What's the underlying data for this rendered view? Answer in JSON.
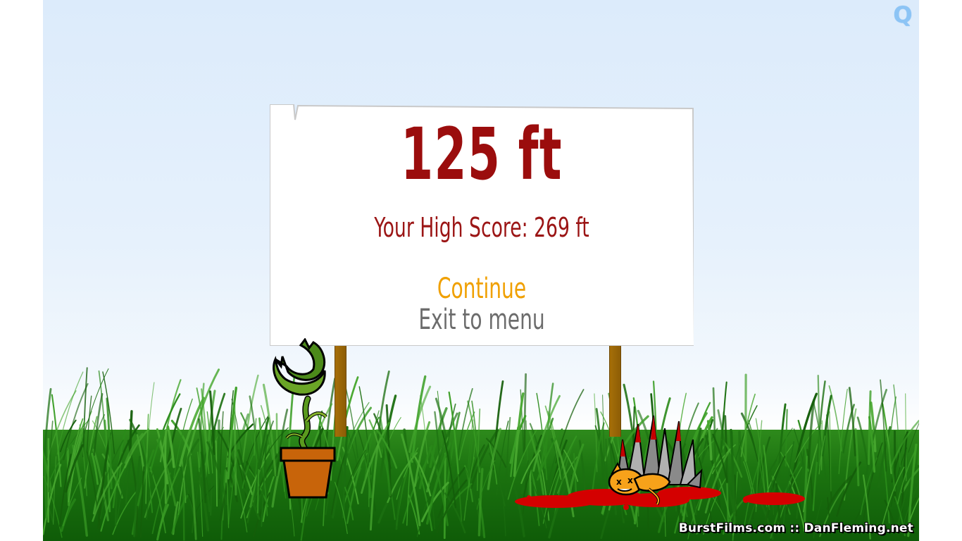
{
  "game": {
    "quality_button": "Q",
    "distance": "125 ft",
    "high_score": "Your High Score: 269 ft",
    "menu": {
      "continue_label": "Continue",
      "exit_label": "Exit to menu"
    },
    "credits": "BurstFilms.com :: DanFleming.net"
  },
  "colors": {
    "sky": "#dcebfb",
    "grass": "#1f7a12",
    "distance_text": "#9b0d0d",
    "continue_text": "#f0a000",
    "exit_text": "#6c6c6c",
    "post": "#a66f08",
    "pot": "#c8640a",
    "kitty": "#f7a21a",
    "blood": "#d40000"
  },
  "icons": [
    "carnivorous-plant-sprite",
    "flower-pot-sprite",
    "spike-trap-sprite",
    "kitty-sprite",
    "blood-splatter"
  ]
}
